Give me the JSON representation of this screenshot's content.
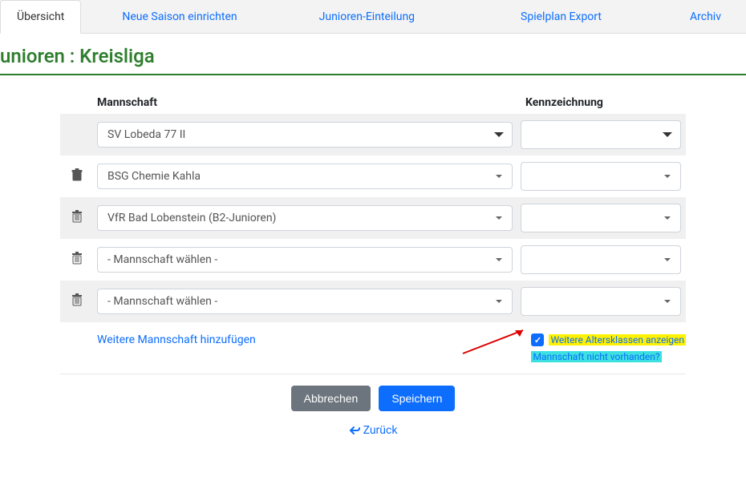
{
  "tabs": {
    "overview": "Übersicht",
    "newSeason": "Neue Saison einrichten",
    "juniors": "Junioren-Einteilung",
    "spielplan": "Spielplan Export",
    "archive": "Archiv"
  },
  "pageTitle": "unioren : Kreisliga",
  "headers": {
    "team": "Mannschaft",
    "kenn": "Kennzeichnung"
  },
  "rows": [
    {
      "team": "SV Lobeda 77 II",
      "hasTrash": false,
      "caret": "bold"
    },
    {
      "team": "BSG Chemie Kahla",
      "hasTrash": true,
      "caret": "small"
    },
    {
      "team": "VfR Bad Lobenstein (B2-Junioren)",
      "hasTrash": true,
      "caret": "small"
    },
    {
      "team": "- Mannschaft wählen -",
      "hasTrash": true,
      "caret": "small"
    },
    {
      "team": "- Mannschaft wählen -",
      "hasTrash": true,
      "caret": "small"
    }
  ],
  "addLink": "Weitere Mannschaft hinzufügen",
  "checkbox": {
    "label1": "Weitere Altersklassen anzeigen",
    "label2": "Mannschaft nicht vorhanden?"
  },
  "buttons": {
    "cancel": "Abbrechen",
    "save": "Speichern",
    "back": "Zurück"
  }
}
